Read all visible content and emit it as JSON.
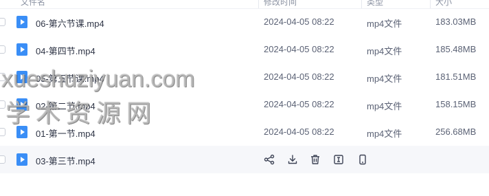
{
  "header": {
    "columns": [
      "文件名",
      "修改时间",
      "类型",
      "大小"
    ]
  },
  "files": [
    {
      "name": "06-第六节课.mp4",
      "modified": "2024-04-05 08:22",
      "type": "mp4文件",
      "size": "183.03MB"
    },
    {
      "name": "04-第四节.mp4",
      "modified": "2024-04-05 08:22",
      "type": "mp4文件",
      "size": "185.48MB"
    },
    {
      "name": "05-第五节课.mp4",
      "modified": "2024-04-05 08:22",
      "type": "mp4文件",
      "size": "181.51MB"
    },
    {
      "name": "02-第二节.mp4",
      "modified": "2024-04-05 08:22",
      "type": "mp4文件",
      "size": "158.15MB"
    },
    {
      "name": "01-第一节.mp4",
      "modified": "2024-04-05 08:22",
      "type": "mp4文件",
      "size": "256.68MB"
    },
    {
      "name": "03-第三节.mp4"
    }
  ],
  "row_actions": [
    "share-icon",
    "download-icon",
    "delete-icon",
    "rename-icon",
    "mobile-icon"
  ],
  "watermark": {
    "line1": "xueshuziyuan.com",
    "line2": "学术资源网"
  },
  "colors": {
    "accent": "#3a8ef6",
    "hover_row": "#f6f7fa",
    "text": "#2e3445",
    "muted": "#5b6275"
  }
}
